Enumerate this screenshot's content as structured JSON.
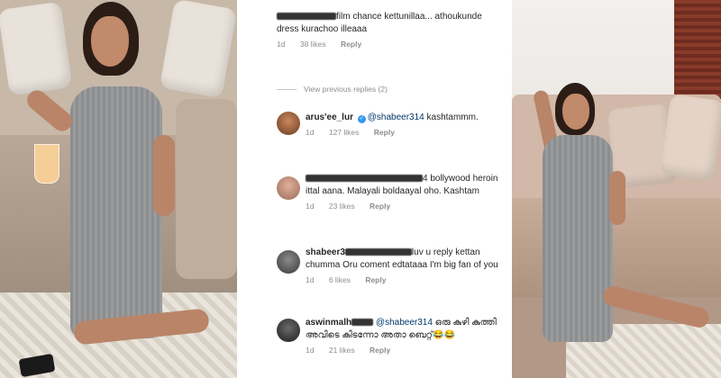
{
  "top_comment": {
    "text": "film chance kettunillaa... athoukunde dress kurachoo illeaaa",
    "time": "1d",
    "likes": "38 likes",
    "reply": "Reply"
  },
  "view_previous": "View previous replies (2)",
  "comments": [
    {
      "user": "arus'ee_lur",
      "mention": "@shabeer314",
      "text": " kashtammm.",
      "time": "1d",
      "likes": "127 likes",
      "reply": "Reply"
    },
    {
      "text": "4 bollywood heroin ittal aana. Malayali boldaayal oho. Kashtam",
      "time": "1d",
      "likes": "23 likes",
      "reply": "Reply"
    },
    {
      "user": "shabeer3",
      "text": "luv u reply kettan chumma Oru coment edtataaa I'm big fan of you",
      "time": "1d",
      "likes": "6 likes",
      "reply": "Reply"
    },
    {
      "user": "aswinmalh",
      "mention": "@shabeer314",
      "text": " ഒരു കുഴി കുത്തി അവിടെ കിടന്നോ അതാ ബെറ്റ്😂😂",
      "time": "1d",
      "likes": "21 likes",
      "reply": "Reply"
    }
  ],
  "colors": {
    "text": "#262626",
    "muted": "#8e8e8e",
    "verified": "#3897f0"
  }
}
